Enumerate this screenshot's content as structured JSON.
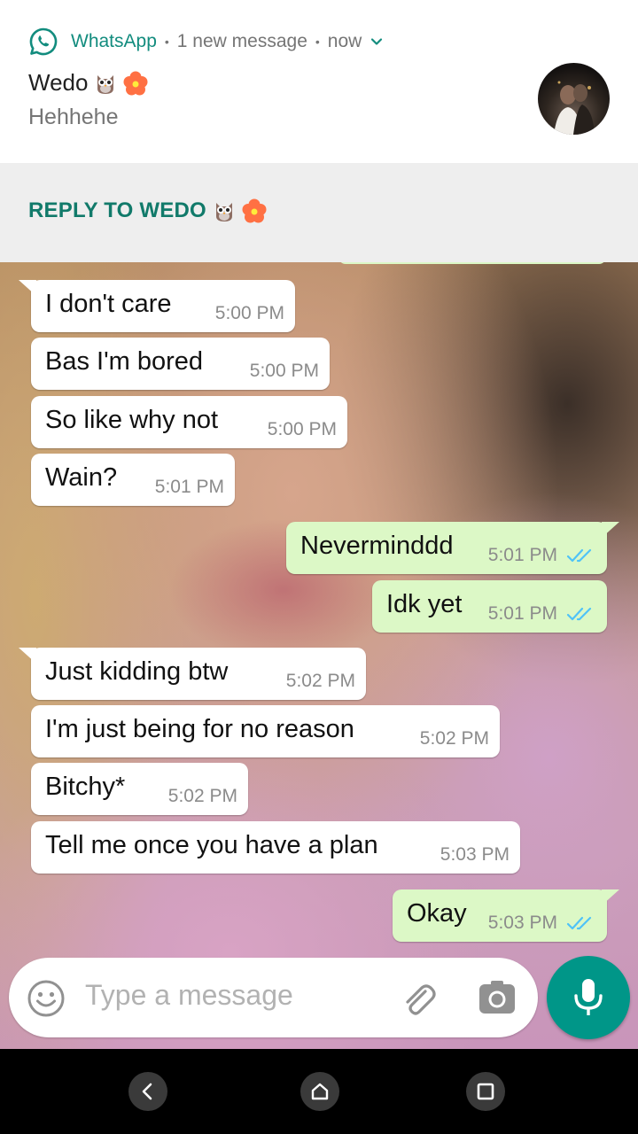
{
  "notification": {
    "app_name": "WhatsApp",
    "separator": "•",
    "summary": "1 new message",
    "time": "now",
    "sender": "Wedo",
    "message": "Hehhehe",
    "sender_emojis": [
      "owl",
      "hibiscus"
    ]
  },
  "reply": {
    "label": "REPLY TO WEDO"
  },
  "messages": [
    {
      "direction": "in",
      "text": "I don't care",
      "time": "5:00 PM"
    },
    {
      "direction": "in",
      "text": "Bas I'm bored",
      "time": "5:00 PM"
    },
    {
      "direction": "in",
      "text": "So like why not",
      "time": "5:00 PM"
    },
    {
      "direction": "in",
      "text": "Wain?",
      "time": "5:01 PM"
    },
    {
      "direction": "out",
      "text": "Neverminddd",
      "time": "5:01 PM",
      "status": "read"
    },
    {
      "direction": "out",
      "text": "Idk yet",
      "time": "5:01 PM",
      "status": "read"
    },
    {
      "direction": "in",
      "text": "Just kidding btw",
      "time": "5:02 PM"
    },
    {
      "direction": "in",
      "text": "I'm just being for no reason",
      "time": "5:02 PM"
    },
    {
      "direction": "in",
      "text": "Bitchy*",
      "time": "5:02 PM"
    },
    {
      "direction": "in",
      "text": "Tell me once you have a plan",
      "time": "5:03 PM"
    },
    {
      "direction": "out",
      "text": "Okay",
      "time": "5:03 PM",
      "status": "read"
    }
  ],
  "composer": {
    "placeholder": "Type a message"
  },
  "icons": {
    "app": "whatsapp-icon",
    "expand": "chevron-down-icon",
    "emoji": "smiley-icon",
    "attach": "paperclip-icon",
    "camera": "camera-icon",
    "mic": "microphone-icon",
    "nav": [
      "back-icon",
      "home-icon",
      "recents-icon"
    ]
  },
  "colors": {
    "whatsapp_green": "#128c7e",
    "outgoing_bubble": "#dcf8c6",
    "incoming_bubble": "#ffffff",
    "mic_button": "#009688",
    "read_ticks": "#4fc3f7"
  }
}
